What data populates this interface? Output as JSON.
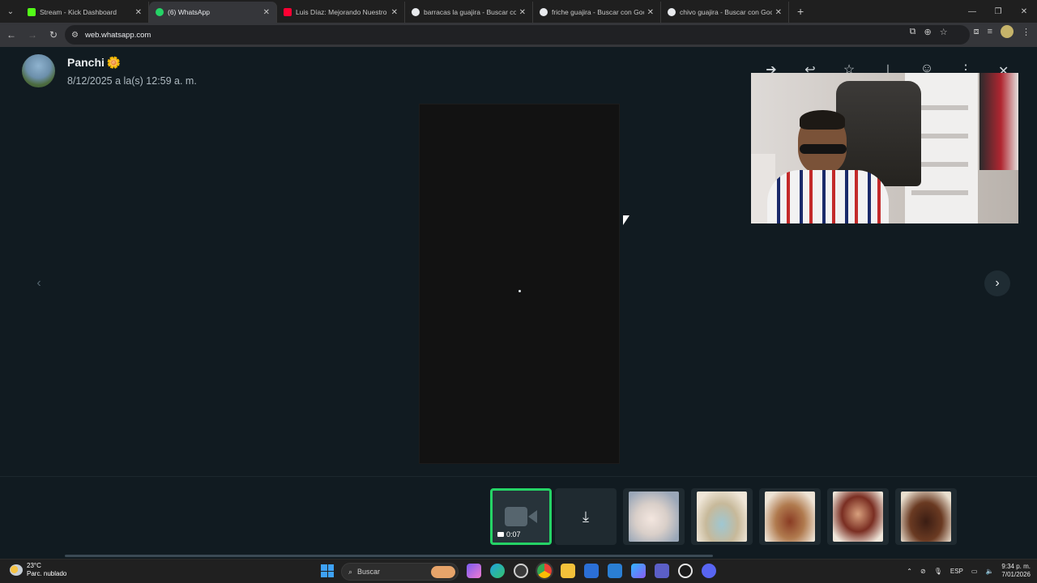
{
  "browser": {
    "tabs": [
      {
        "label": "Stream - Kick Dashboard",
        "icon": "kick-icon",
        "color": "#53fc18",
        "active": false
      },
      {
        "label": "(6) WhatsApp",
        "icon": "whatsapp-icon",
        "color": "#25d366",
        "active": true
      },
      {
        "label": "Luis Díaz: Mejorando Nuestro I",
        "icon": "youtube-icon",
        "color": "#ff0033",
        "active": false
      },
      {
        "label": "barracas la guajira - Buscar con",
        "icon": "google-icon",
        "color": "#e8eaed",
        "active": false
      },
      {
        "label": "friche guajira - Buscar con Goo",
        "icon": "google-icon",
        "color": "#e8eaed",
        "active": false
      },
      {
        "label": "chivo guajira - Buscar con Goo",
        "icon": "google-icon",
        "color": "#e8eaed",
        "active": false
      }
    ],
    "new_tab": "+",
    "url": "web.whatsapp.com"
  },
  "viewer": {
    "contact_name": "Panchi",
    "contact_emoji": "🌼",
    "timestamp": "8/12/2025 a la(s) 12:59 a. m.",
    "thumbs": {
      "video_duration": "0:07"
    }
  },
  "taskbar": {
    "temperature": "23°C",
    "weather": "Parc. nublado",
    "search_placeholder": "Buscar",
    "language": "ESP",
    "time": "9:34 p. m.",
    "date": "7/01/2026"
  },
  "colors": {
    "accent": "#25d366",
    "viewer_bg": "#111b21"
  }
}
